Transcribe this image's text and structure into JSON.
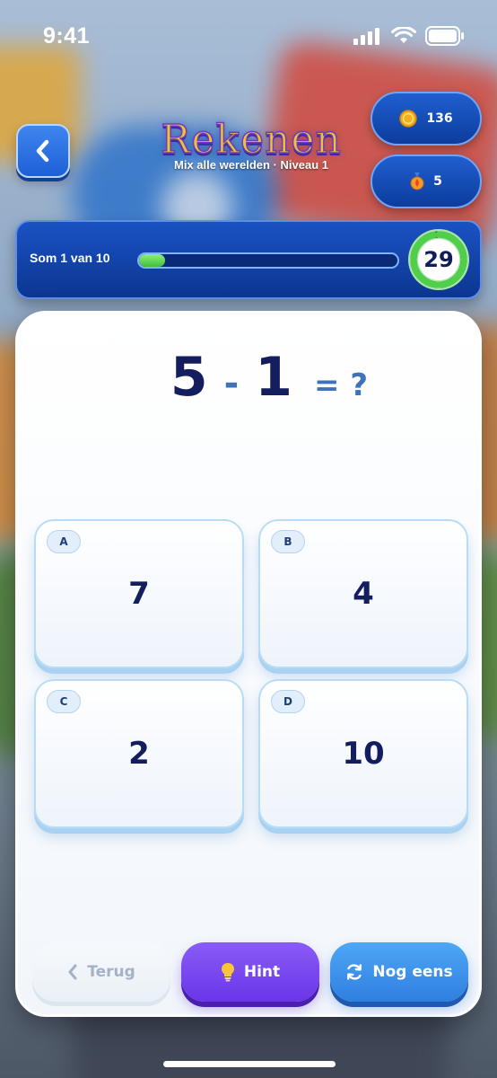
{
  "status_bar": {
    "time": "9:41"
  },
  "header": {
    "title": "Rekenen",
    "subtitle": "Mix alle werelden · Niveau 1",
    "coins": "136",
    "streak": "5"
  },
  "progress": {
    "label": "Som 1 van 10",
    "fraction": 0.1,
    "timer": "29",
    "timer_fraction": 0.97
  },
  "question": {
    "left": "5",
    "operator": "-",
    "right": "1",
    "equals": "= ?"
  },
  "answers": [
    {
      "letter": "A",
      "value": "7"
    },
    {
      "letter": "B",
      "value": "4"
    },
    {
      "letter": "C",
      "value": "2"
    },
    {
      "letter": "D",
      "value": "10"
    }
  ],
  "footer": {
    "back_label": "Terug",
    "hint_label": "Hint",
    "retry_label": "Nog eens"
  },
  "icons": {
    "back": "chevron-left-icon",
    "coin": "coin-icon",
    "streak": "medal-flame-icon",
    "hint": "lightbulb-icon",
    "retry": "refresh-icon"
  },
  "colors": {
    "primary_blue": "#1e5fd6",
    "title_gold": "#f4c22f",
    "hint_purple": "#6a35e8",
    "retry_blue": "#2f7fe0",
    "progress_green": "#3fbf3a",
    "text_navy": "#141e5e"
  }
}
